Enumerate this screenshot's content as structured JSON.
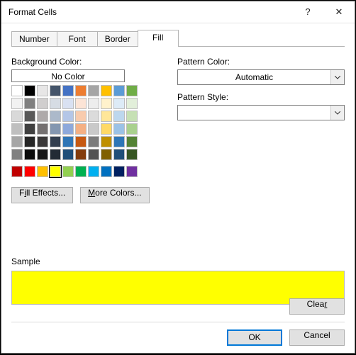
{
  "window": {
    "title": "Format Cells",
    "help": "?",
    "close": "✕"
  },
  "tabs": {
    "number": "Number",
    "font": "Font",
    "border": "Border",
    "fill": "Fill",
    "active": "fill"
  },
  "fill": {
    "bg_label": "Background Color:",
    "no_color": "No Color",
    "selected_color": "#FFFF00",
    "palette_main": [
      "#FFFFFF",
      "#000000",
      "#E7E6E6",
      "#44546A",
      "#4472C4",
      "#ED7D31",
      "#A5A5A5",
      "#FFC000",
      "#5B9BD5",
      "#70AD47",
      "#F2F2F2",
      "#808080",
      "#D0CECE",
      "#D6DCE4",
      "#D9E1F2",
      "#FCE4D6",
      "#EDEDED",
      "#FFF2CC",
      "#DDEBF7",
      "#E2EFDA",
      "#D9D9D9",
      "#595959",
      "#AEAAAA",
      "#ACB9CA",
      "#B4C6E7",
      "#F8CBAD",
      "#DBDBDB",
      "#FFE699",
      "#BDD7EE",
      "#C6E0B4",
      "#BFBFBF",
      "#404040",
      "#757171",
      "#8497B0",
      "#8EA9DB",
      "#F4B084",
      "#C9C9C9",
      "#FFD966",
      "#9BC2E6",
      "#A9D08E",
      "#A6A6A6",
      "#262626",
      "#3A3838",
      "#333F4F",
      "#2F75B5",
      "#C65911",
      "#7B7B7B",
      "#BF8F00",
      "#2E75B6",
      "#548235",
      "#808080",
      "#0D0D0D",
      "#161616",
      "#222B35",
      "#1F4E78",
      "#833C0C",
      "#525252",
      "#806000",
      "#1F4E78",
      "#375623"
    ],
    "palette_std": [
      "#C00000",
      "#FF0000",
      "#FFC000",
      "#FFFF00",
      "#92D050",
      "#00B050",
      "#00B0F0",
      "#0070C0",
      "#002060",
      "#7030A0"
    ],
    "fill_effects_pre": "F",
    "fill_effects_ul": "i",
    "fill_effects_post": "ll Effects...",
    "more_colors_pre": "",
    "more_colors_ul": "M",
    "more_colors_post": "ore Colors...",
    "pattern_color_label": "Pattern Color:",
    "pattern_color_value": "Automatic",
    "pattern_style_label": "Pattern Style:",
    "pattern_style_value": ""
  },
  "sample": {
    "label": "Sample",
    "color": "#FFFF00"
  },
  "buttons": {
    "clear_pre": "Clea",
    "clear_ul": "r",
    "clear_post": "",
    "ok": "OK",
    "cancel": "Cancel"
  }
}
